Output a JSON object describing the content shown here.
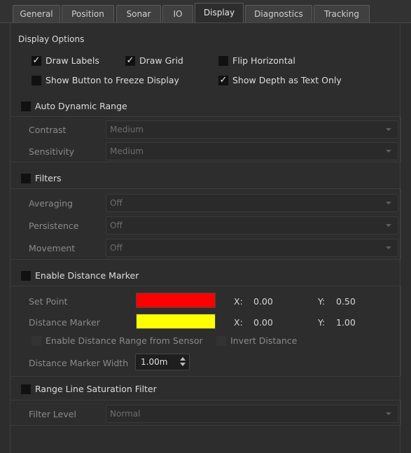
{
  "tabs": [
    {
      "label": "General"
    },
    {
      "label": "Position"
    },
    {
      "label": "Sonar"
    },
    {
      "label": "IO"
    },
    {
      "label": "Display"
    },
    {
      "label": "Diagnostics"
    },
    {
      "label": "Tracking"
    }
  ],
  "active_tab": "Display",
  "display_options": {
    "title": "Display Options",
    "draw_labels": {
      "label": "Draw Labels",
      "checked": true
    },
    "draw_grid": {
      "label": "Draw Grid",
      "checked": true
    },
    "flip_horizontal": {
      "label": "Flip Horizontal",
      "checked": false
    },
    "freeze_button": {
      "label": "Show Button to Freeze Display",
      "checked": false
    },
    "depth_text": {
      "label": "Show Depth as Text Only",
      "checked": true
    }
  },
  "auto_dynamic_range": {
    "label": "Auto Dynamic Range",
    "checked": false,
    "contrast": {
      "label": "Contrast",
      "value": "Medium"
    },
    "sensitivity": {
      "label": "Sensitivity",
      "value": "Medium"
    }
  },
  "filters": {
    "label": "Filters",
    "checked": false,
    "averaging": {
      "label": "Averaging",
      "value": "Off"
    },
    "persistence": {
      "label": "Persistence",
      "value": "Off"
    },
    "movement": {
      "label": "Movement",
      "value": "Off"
    }
  },
  "distance_marker": {
    "label": "Enable Distance Marker",
    "checked": false,
    "set_point": {
      "label": "Set Point",
      "color": "#ff0000",
      "x_label": "X:",
      "x": "0.00",
      "y_label": "Y:",
      "y": "0.50"
    },
    "marker": {
      "label": "Distance Marker",
      "color": "#ffff00",
      "x_label": "X:",
      "x": "0.00",
      "y_label": "Y:",
      "y": "1.00"
    },
    "range_from_sensor": {
      "label": "Enable Distance Range from Sensor",
      "checked": false
    },
    "invert": {
      "label": "Invert Distance",
      "checked": false
    },
    "width": {
      "label": "Distance Marker Width",
      "value": "1.00m"
    }
  },
  "range_line": {
    "label": "Range Line Saturation Filter",
    "checked": false,
    "filter_level": {
      "label": "Filter Level",
      "value": "Normal"
    }
  },
  "check_glyph": "✓"
}
